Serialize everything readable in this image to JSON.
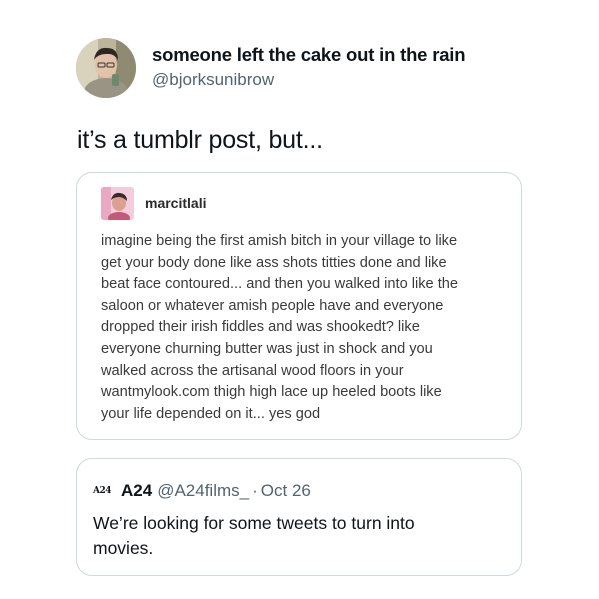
{
  "author": {
    "display_name": "someone left the cake out in the rain",
    "handle": "@bjorksunibrow",
    "avatar_icon": "profile-photo"
  },
  "tweet": {
    "text": "it’s a tumblr post, but..."
  },
  "tumblr_post": {
    "username": "marcitlali",
    "avatar_icon": "profile-photo",
    "lines": [
      "imagine being the first amish bitch in your village to like",
      "get your body done like ass shots titties done and like",
      "beat face contoured... and then you walked into like the",
      "saloon or whatever amish people have and everyone",
      "dropped their irish fiddles and was shookedt? like",
      "everyone churning butter was just in shock and you",
      "walked across the artisanal wood floors in your",
      "wantmylook.com thigh high lace up heeled boots like",
      "your life depended on it... yes god"
    ]
  },
  "quoted_tweet": {
    "logo_text": "A24",
    "name": "A24",
    "handle": "@A24films_",
    "separator": "·",
    "date": "Oct 26",
    "lines": [
      "We’re looking for some tweets to turn into",
      "movies."
    ]
  },
  "colors": {
    "text_primary": "#0f1419",
    "text_secondary": "#536471",
    "border": "#cfd9de"
  }
}
